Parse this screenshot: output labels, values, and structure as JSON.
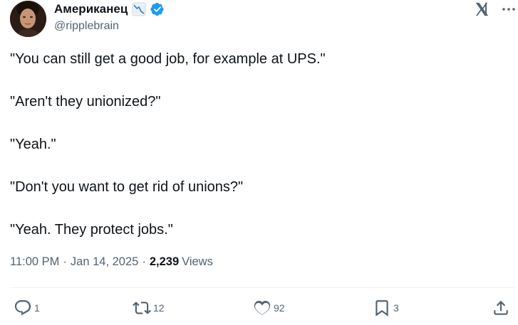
{
  "author": {
    "display_name": "Американец",
    "handle": "@ripplebrain",
    "name_emoji": "chart-decreasing-icon",
    "verified_badge": "verified-badge-icon",
    "verified_color": "#1d9bf0"
  },
  "tweet": {
    "paragraphs": [
      "\"You can still get a good job, for example at UPS.\"",
      "\"Aren't they unionized?\"",
      "\"Yeah.\"",
      "\"Don't you want to get rid of unions?\"",
      "\"Yeah. They protect jobs.\""
    ]
  },
  "meta": {
    "time": "11:00 PM",
    "separator": "·",
    "date": "Jan 14, 2025",
    "views_count": "2,239",
    "views_label": "Views"
  },
  "actions": {
    "replies": "1",
    "reposts": "12",
    "likes": "92",
    "bookmarks": "3"
  },
  "icons": {
    "x_logo": "x-logo-icon",
    "reply": "reply-icon",
    "repost": "repost-icon",
    "like": "heart-icon",
    "bookmark": "bookmark-icon",
    "share": "share-icon"
  },
  "colors": {
    "text": "#0f1419",
    "secondary": "#536471",
    "divider": "#eff3f4"
  }
}
